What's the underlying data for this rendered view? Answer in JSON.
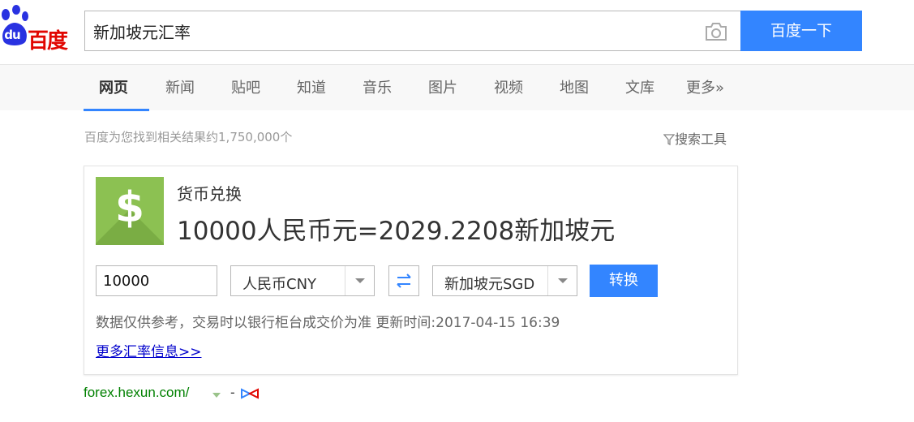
{
  "logo": {
    "du": "du",
    "brand": "百度"
  },
  "search": {
    "query": "新加坡元汇率",
    "button_label": "百度一下"
  },
  "tabs": [
    {
      "label": "网页"
    },
    {
      "label": "新闻"
    },
    {
      "label": "贴吧"
    },
    {
      "label": "知道"
    },
    {
      "label": "音乐"
    },
    {
      "label": "图片"
    },
    {
      "label": "视频"
    },
    {
      "label": "地图"
    },
    {
      "label": "文库"
    },
    {
      "label": "更多»"
    }
  ],
  "results": {
    "count_text": "百度为您找到相关结果约1,750,000个",
    "tools_label": "搜索工具"
  },
  "converter": {
    "title": "货币兑换",
    "result": "10000人民币元=2029.2208新加坡元",
    "amount": "10000",
    "from_currency": "人民币CNY",
    "to_currency": "新加坡元SGD",
    "convert_label": "转换",
    "disclaimer": "数据仅供参考，交易时以银行柜台成交价为准 更新时间:2017-04-15 16:39",
    "more_link": "更多汇率信息>>",
    "icon_symbol": "$"
  },
  "result_url": {
    "text": "forex.hexun.com/",
    "dash": "-"
  },
  "colors": {
    "accent": "#3385ff",
    "brand_red": "#e10601",
    "icon_green": "#8cc152",
    "link": "#0000cc",
    "url_green": "#008000"
  }
}
